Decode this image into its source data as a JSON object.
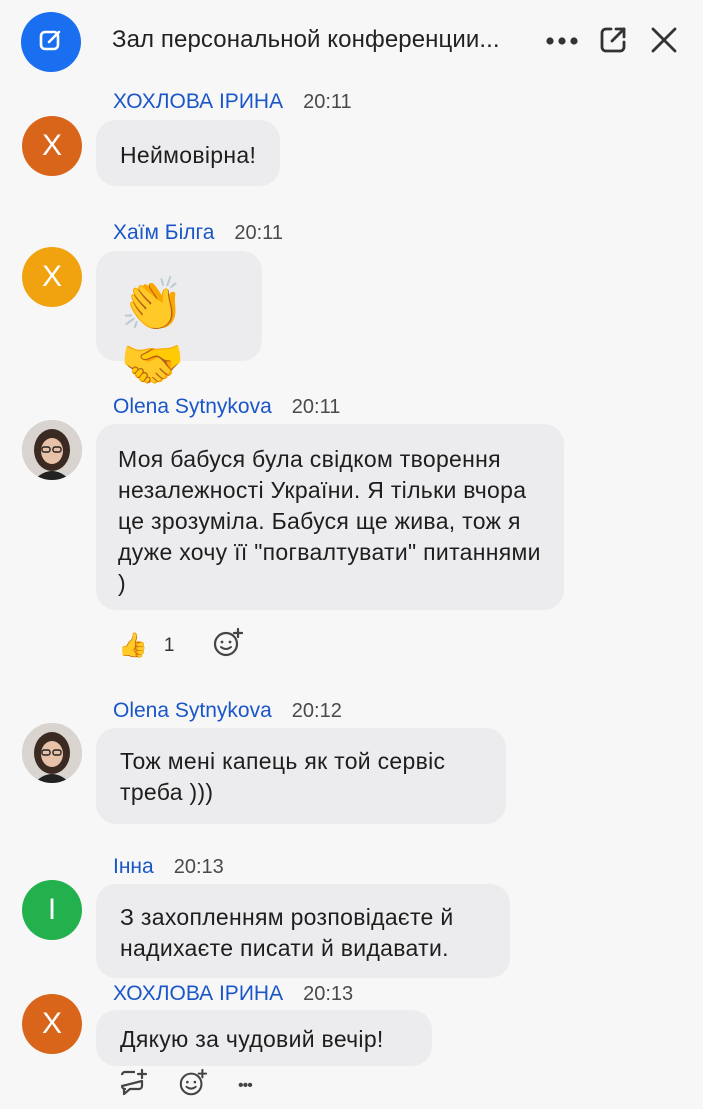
{
  "header": {
    "title": "Зал персональной конференции...",
    "app_icon": "edit-square-icon",
    "more_label": "•••"
  },
  "colors": {
    "accent": "#1a6ff0",
    "sender": "#1a56c7",
    "bubble": "#ececee",
    "avatar_orange": "#d9651a",
    "avatar_yellow": "#f0a30f",
    "avatar_green": "#23b14d"
  },
  "messages": [
    {
      "sender": "ХОХЛОВА ІРИНА",
      "time": "20:11",
      "avatar_initial": "Х",
      "text": "Неймовірна!"
    },
    {
      "sender": "Хаїм Білга",
      "time": "20:11",
      "avatar_initial": "Х",
      "text": "👏🤝"
    },
    {
      "sender": "Olena Sytnykova",
      "time": "20:11",
      "avatar_initial": "",
      "text": "Моя бабуся була свідком творення незалежності України. Я тільки вчора це зрозуміла. Бабуся ще жива, тож я дуже хочу її \"погвалтувати\" питаннями )",
      "reaction": {
        "emoji": "👍",
        "count": "1"
      }
    },
    {
      "sender": "Olena Sytnykova",
      "time": "20:12",
      "avatar_initial": "",
      "text": "Тож мені капець як той сервіс треба )))"
    },
    {
      "sender": "Інна",
      "time": "20:13",
      "avatar_initial": "І",
      "text": "З захопленням розповідаєте й надихаєте писати й видавати."
    },
    {
      "sender": "ХОХЛОВА ІРИНА",
      "time": "20:13",
      "avatar_initial": "Х",
      "text": "Дякую за чудовий вечір!"
    }
  ],
  "footer_actions": {
    "more_label": "•••"
  }
}
